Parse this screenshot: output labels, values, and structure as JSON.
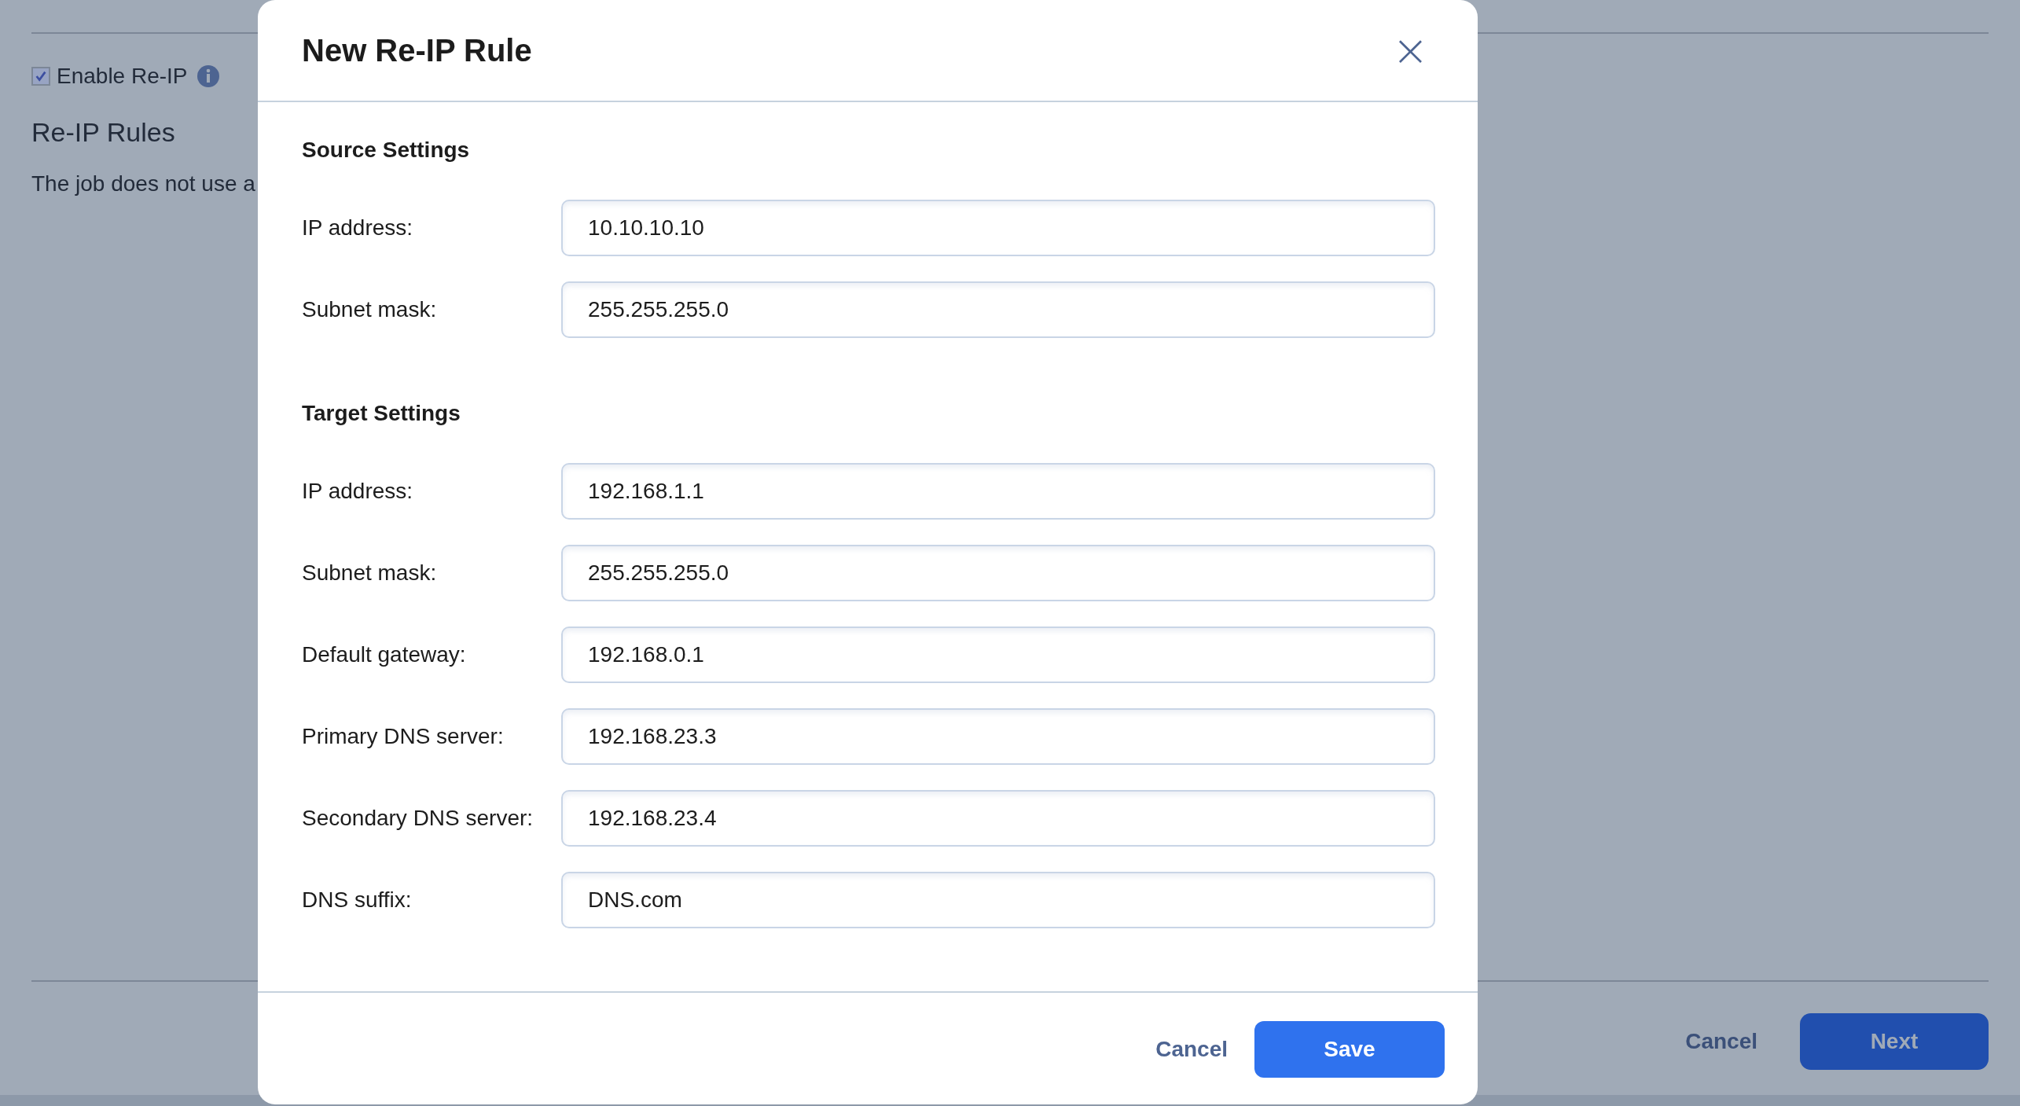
{
  "page": {
    "enable_reip": {
      "label": "Enable Re-IP",
      "checked": true
    },
    "heading": "Re-IP Rules",
    "text": "The job does not use a",
    "buttons": [
      {
        "label": "Cancel",
        "kind": "link"
      },
      {
        "label": "Next",
        "kind": "primary"
      }
    ]
  },
  "dialog": {
    "title": "New Re-IP Rule",
    "close": "×",
    "sections": [
      {
        "title": "Source Settings",
        "fields": [
          {
            "label": "IP address:",
            "value": "10.10.10.10"
          },
          {
            "label": "Subnet mask:",
            "value": "255.255.255.0"
          }
        ]
      },
      {
        "title": "Target Settings",
        "fields": [
          {
            "label": "IP address:",
            "value": "192.168.1.1"
          },
          {
            "label": "Subnet mask:",
            "value": "255.255.255.0"
          },
          {
            "label": "Default gateway:",
            "value": "192.168.0.1"
          },
          {
            "label": "Primary DNS server:",
            "value": "192.168.23.3"
          },
          {
            "label": "Secondary DNS server:",
            "value": "192.168.23.4"
          },
          {
            "label": "DNS suffix:",
            "value": "DNS.com"
          }
        ]
      }
    ],
    "buttons": [
      {
        "label": "Cancel",
        "kind": "link"
      },
      {
        "label": "Save",
        "kind": "primary"
      }
    ]
  }
}
